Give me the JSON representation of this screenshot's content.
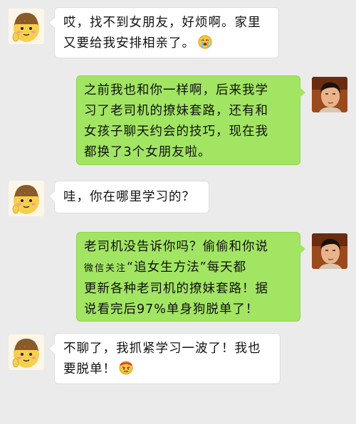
{
  "messages": [
    {
      "side": "left",
      "avatar": "cartoon-girl-avatar",
      "lines": [
        "哎，找不到女朋友，好烦啊。家里",
        "又要给我安排相亲了。"
      ],
      "emoji": "crying-face-emoji"
    },
    {
      "side": "right",
      "avatar": "man-photo-avatar",
      "lines": [
        "之前我也和你一样啊，后来我学",
        "习了老司机的撩妹套路，还有和",
        "女孩子聊天约会的技巧，现在我",
        "都换了3个女朋友啦。"
      ]
    },
    {
      "side": "left",
      "avatar": "cartoon-girl-avatar",
      "lines": [
        "哇，你在哪里学习的？"
      ]
    },
    {
      "side": "right",
      "avatar": "man-photo-avatar",
      "line1": "老司机没告诉你吗？偷偷和你说",
      "line2_small": "微信关注",
      "line2_rest": "“追女生方法”每天都",
      "line3": "更新各种老司机的撩妹套路！据",
      "line4": "说看完后97%单身狗脱单了！"
    },
    {
      "side": "left",
      "avatar": "cartoon-girl-avatar",
      "lines": [
        "不聊了，我抓紧学习一波了！我也",
        "要脱单！"
      ],
      "emoji": "determined-face-emoji"
    }
  ],
  "colors": {
    "background": "#ebebeb",
    "sent_bubble": "#a2e563",
    "received_bubble": "#ffffff"
  }
}
